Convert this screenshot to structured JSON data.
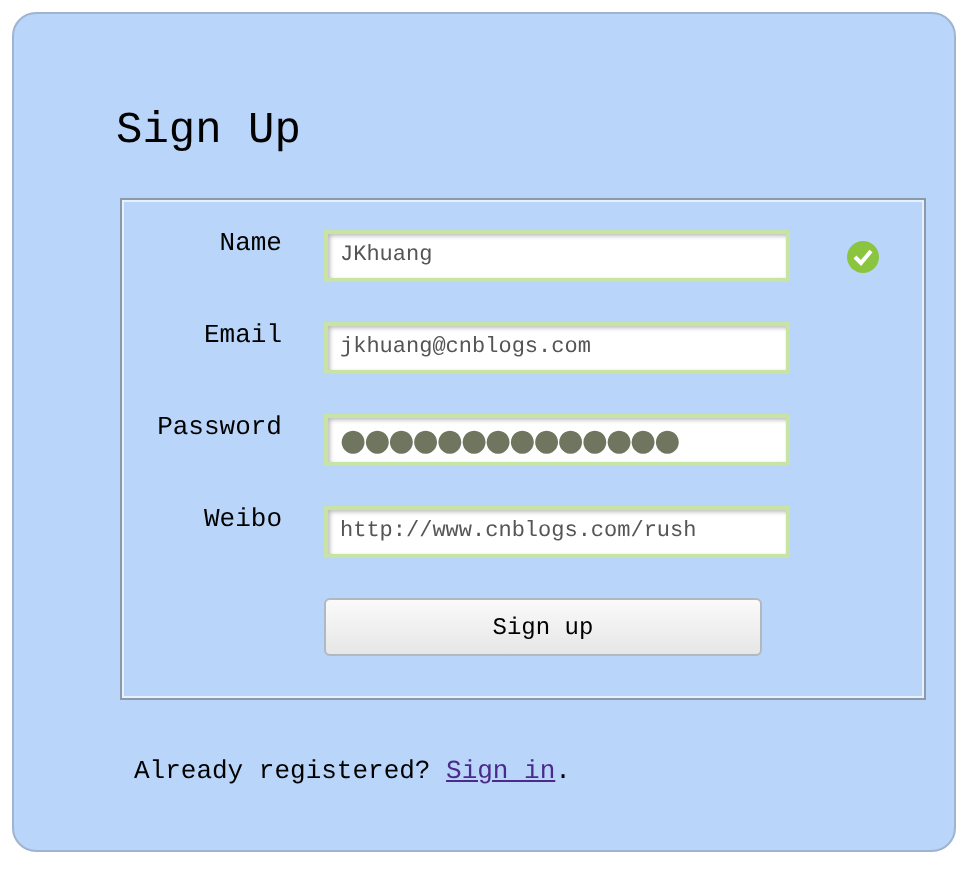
{
  "title": "Sign Up",
  "fields": [
    {
      "label": "Name",
      "kind": "text",
      "value": "JKhuang",
      "valid": true
    },
    {
      "label": "Email",
      "kind": "text",
      "value": "jkhuang@cnblogs.com",
      "valid": false
    },
    {
      "label": "Password",
      "kind": "password",
      "value": "●●●●●●●●●●●●●●",
      "valid": false
    },
    {
      "label": "Weibo",
      "kind": "text",
      "value": "http://www.cnblogs.com/rush",
      "valid": false
    }
  ],
  "submit": "Sign up",
  "footer": {
    "text": "Already registered? ",
    "link": "Sign in",
    "end": "."
  }
}
